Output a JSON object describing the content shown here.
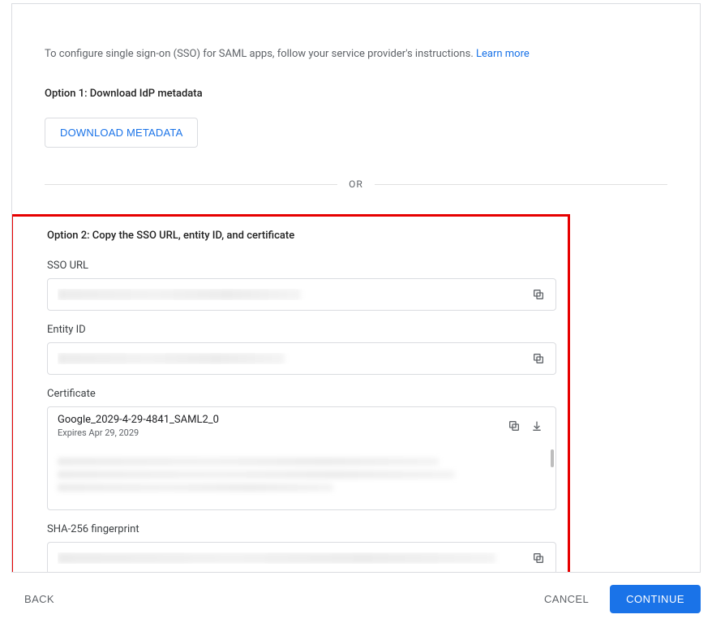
{
  "intro": {
    "text": "To configure single sign-on (SSO) for SAML apps, follow your service provider's instructions. ",
    "learn_more": "Learn more"
  },
  "option1": {
    "title": "Option 1: Download IdP metadata",
    "download_label": "DOWNLOAD METADATA"
  },
  "divider": {
    "or": "OR"
  },
  "option2": {
    "title": "Option 2: Copy the SSO URL, entity ID, and certificate",
    "sso_url_label": "SSO URL",
    "entity_id_label": "Entity ID",
    "certificate_label": "Certificate",
    "certificate": {
      "name": "Google_2029-4-29-4841_SAML2_0",
      "expires": "Expires Apr 29, 2029"
    },
    "sha_label": "SHA-256 fingerprint"
  },
  "footer": {
    "back": "BACK",
    "cancel": "CANCEL",
    "continue": "CONTINUE"
  }
}
